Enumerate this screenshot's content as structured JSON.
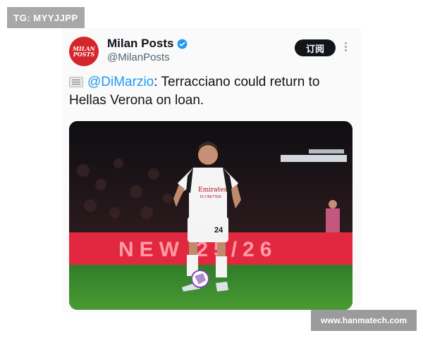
{
  "overlay": {
    "tg_label": "TG: MYYJJPP",
    "watermark": "www.hanmatech.com"
  },
  "tweet": {
    "avatar_text_line1": "MILAN",
    "avatar_text_line2": "POSTS",
    "display_name": "Milan Posts",
    "handle": "@MilanPosts",
    "follow_label": "订阅",
    "mention": "@DiMarzio",
    "text_after_mention": ": Terracciano could return to Hellas Verona on loan.",
    "verified_color": "#1d9bf0"
  },
  "media": {
    "board_text": "NEW   25/26",
    "sponsor_text": "Emirates",
    "sponsor_subtext": "FLY BETTER",
    "shirt_number": "24"
  },
  "colors": {
    "ad_board": "#e2283e",
    "pitch": "#3f8a2f",
    "avatar": "#d3262b"
  }
}
